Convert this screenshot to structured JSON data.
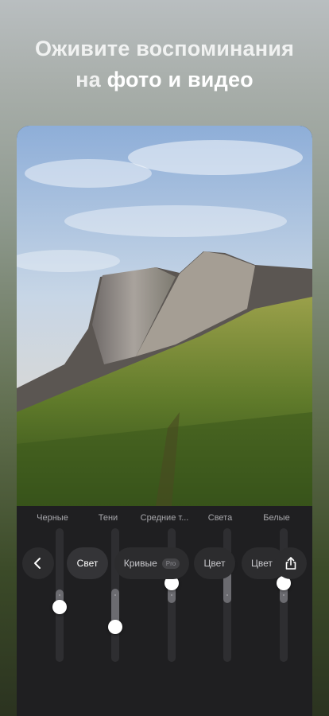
{
  "headline": {
    "line1": "Оживите воспоминания",
    "line2_prefix": "на",
    "line2_strong": "фото и видео"
  },
  "sliders": [
    {
      "label": "Черные",
      "fill_top": 0.46,
      "fill_bottom": 0.6,
      "knob": 0.59
    },
    {
      "label": "Тени",
      "fill_top": 0.45,
      "fill_bottom": 0.74,
      "knob": 0.74
    },
    {
      "label": "Средние т...",
      "fill_top": 0.41,
      "fill_bottom": 0.56,
      "knob": 0.41
    },
    {
      "label": "Света",
      "fill_top": 0.27,
      "fill_bottom": 0.56,
      "knob": 0.27
    },
    {
      "label": "Белые",
      "fill_top": 0.41,
      "fill_bottom": 0.56,
      "knob": 0.41
    }
  ],
  "toolbar": {
    "back_icon": "chevron-left-icon",
    "tabs": [
      "Свет",
      "Кривые",
      "Цвет",
      "Цвет"
    ],
    "pro_badge": "Pro",
    "share_icon": "share-icon"
  },
  "colors": {
    "accent": "#ffffff",
    "panel": "#1f1f21",
    "pill": "#2c2c2e"
  }
}
